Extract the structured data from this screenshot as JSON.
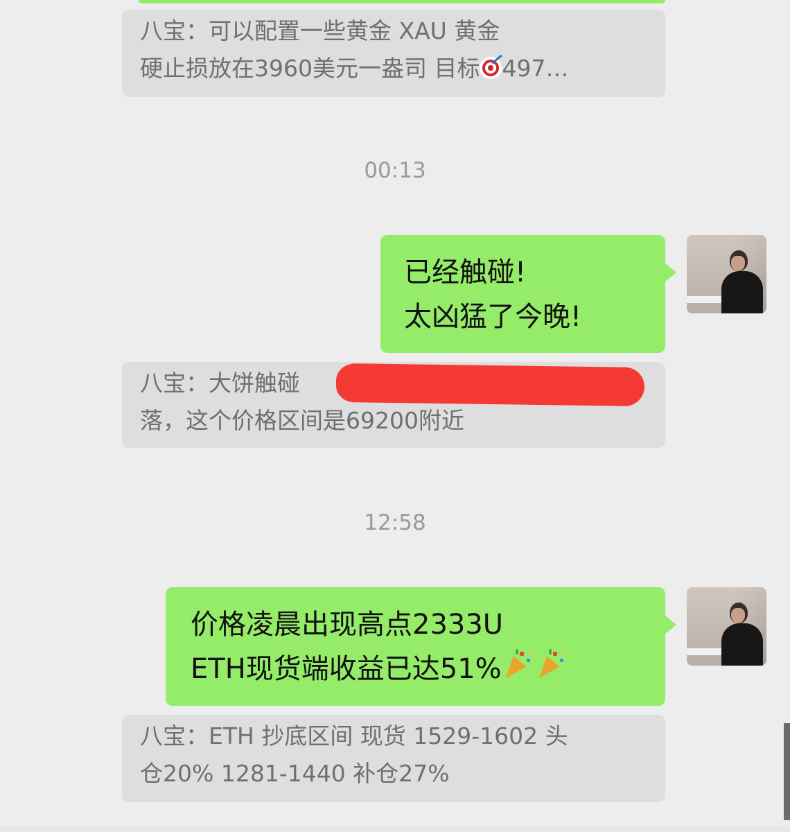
{
  "messages": {
    "quote_1": {
      "line_1": "八宝：可以配置一些黄金 XAU 黄金",
      "line_2_text": "硬止损放在3960美元一盎司 目标",
      "line_2_tail": "497…"
    },
    "time_1": "00:13",
    "bubble_1": {
      "line_1": "已经触碰!",
      "line_2": "太凶猛了今晚!"
    },
    "quote_2": {
      "line_1": "八宝：大饼触碰",
      "line_2": "落，这个价格区间是69200附近"
    },
    "time_2": "12:58",
    "bubble_2": {
      "line_1": "价格凌晨出现高点2333U",
      "line_2": "ETH现货端收益已达51%"
    },
    "quote_3": {
      "line_1": "八宝：ETH 抄底区间 现货 1529-1602 头",
      "line_2": "仓20%  1281-1440 补仓27%"
    }
  },
  "icons": {
    "target": "direct-hit-emoji",
    "party": "party-popper-emoji",
    "avatar": "user-avatar"
  },
  "colors": {
    "outgoing_bubble": "#95ec69",
    "quote_background": "#dedede",
    "chat_background": "#ededed",
    "redaction": "#f53a33"
  }
}
